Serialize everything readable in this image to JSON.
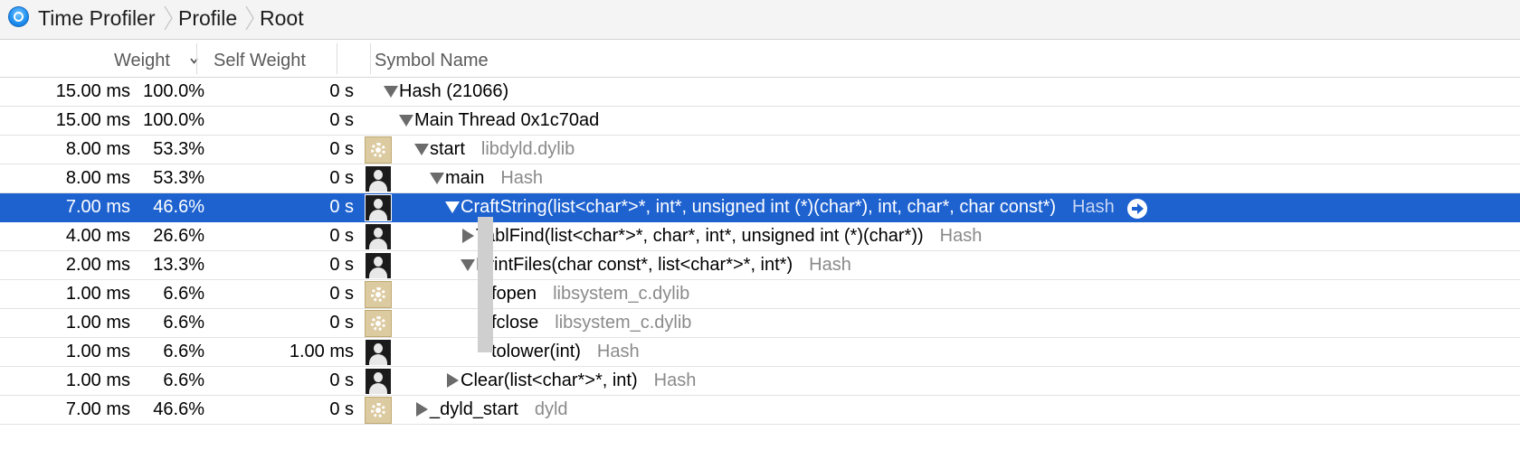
{
  "breadcrumb": {
    "items": [
      "Time Profiler",
      "Profile",
      "Root"
    ]
  },
  "columns": {
    "weight": "Weight",
    "self_weight": "Self Weight",
    "symbol_name": "Symbol Name"
  },
  "colors": {
    "selection": "#1e62d0",
    "library_text": "#8a8a8a",
    "system_icon": "#dccaa0",
    "user_icon": "#1b1b1b"
  },
  "rows": [
    {
      "weight_ms": "15.00 ms",
      "weight_pct": "100.0%",
      "self": "0 s",
      "icon": "none",
      "disclosure": "expanded",
      "symbol": "Hash (21066)",
      "library": ""
    },
    {
      "weight_ms": "15.00 ms",
      "weight_pct": "100.0%",
      "self": "0 s",
      "icon": "none",
      "disclosure": "expanded",
      "symbol": "Main Thread  0x1c70ad",
      "library": ""
    },
    {
      "weight_ms": "8.00 ms",
      "weight_pct": "53.3%",
      "self": "0 s",
      "icon": "gear-icon",
      "disclosure": "expanded",
      "symbol": "start",
      "library": "libdyld.dylib"
    },
    {
      "weight_ms": "8.00 ms",
      "weight_pct": "53.3%",
      "self": "0 s",
      "icon": "user-icon",
      "disclosure": "expanded",
      "symbol": "main",
      "library": "Hash"
    },
    {
      "weight_ms": "7.00 ms",
      "weight_pct": "46.6%",
      "self": "0 s",
      "icon": "user-icon",
      "disclosure": "expanded",
      "symbol": "CraftString(list<char*>*, int*, unsigned int (*)(char*), int, char*, char const*)",
      "library": "Hash",
      "selected": true
    },
    {
      "weight_ms": "4.00 ms",
      "weight_pct": "26.6%",
      "self": "0 s",
      "icon": "user-icon",
      "disclosure": "collapsed",
      "symbol": "TablFind(list<char*>*, char*, int*, unsigned int (*)(char*))",
      "library": "Hash"
    },
    {
      "weight_ms": "2.00 ms",
      "weight_pct": "13.3%",
      "self": "0 s",
      "icon": "user-icon",
      "disclosure": "expanded",
      "symbol": "PrintFiles(char const*, list<char*>*, int*)",
      "library": "Hash"
    },
    {
      "weight_ms": "1.00 ms",
      "weight_pct": "6.6%",
      "self": "0 s",
      "icon": "gear-icon",
      "disclosure": "collapsed",
      "symbol": "fopen",
      "library": "libsystem_c.dylib"
    },
    {
      "weight_ms": "1.00 ms",
      "weight_pct": "6.6%",
      "self": "0 s",
      "icon": "gear-icon",
      "disclosure": "collapsed",
      "symbol": "fclose",
      "library": "libsystem_c.dylib"
    },
    {
      "weight_ms": "1.00 ms",
      "weight_pct": "6.6%",
      "self": "1.00 ms",
      "icon": "user-icon",
      "disclosure": "none",
      "symbol": "tolower(int)",
      "library": "Hash"
    },
    {
      "weight_ms": "1.00 ms",
      "weight_pct": "6.6%",
      "self": "0 s",
      "icon": "user-icon",
      "disclosure": "collapsed",
      "symbol": "Clear(list<char*>*, int)",
      "library": "Hash"
    },
    {
      "weight_ms": "7.00 ms",
      "weight_pct": "46.6%",
      "self": "0 s",
      "icon": "gear-icon",
      "disclosure": "collapsed",
      "symbol": "_dyld_start",
      "library": "dyld"
    }
  ]
}
